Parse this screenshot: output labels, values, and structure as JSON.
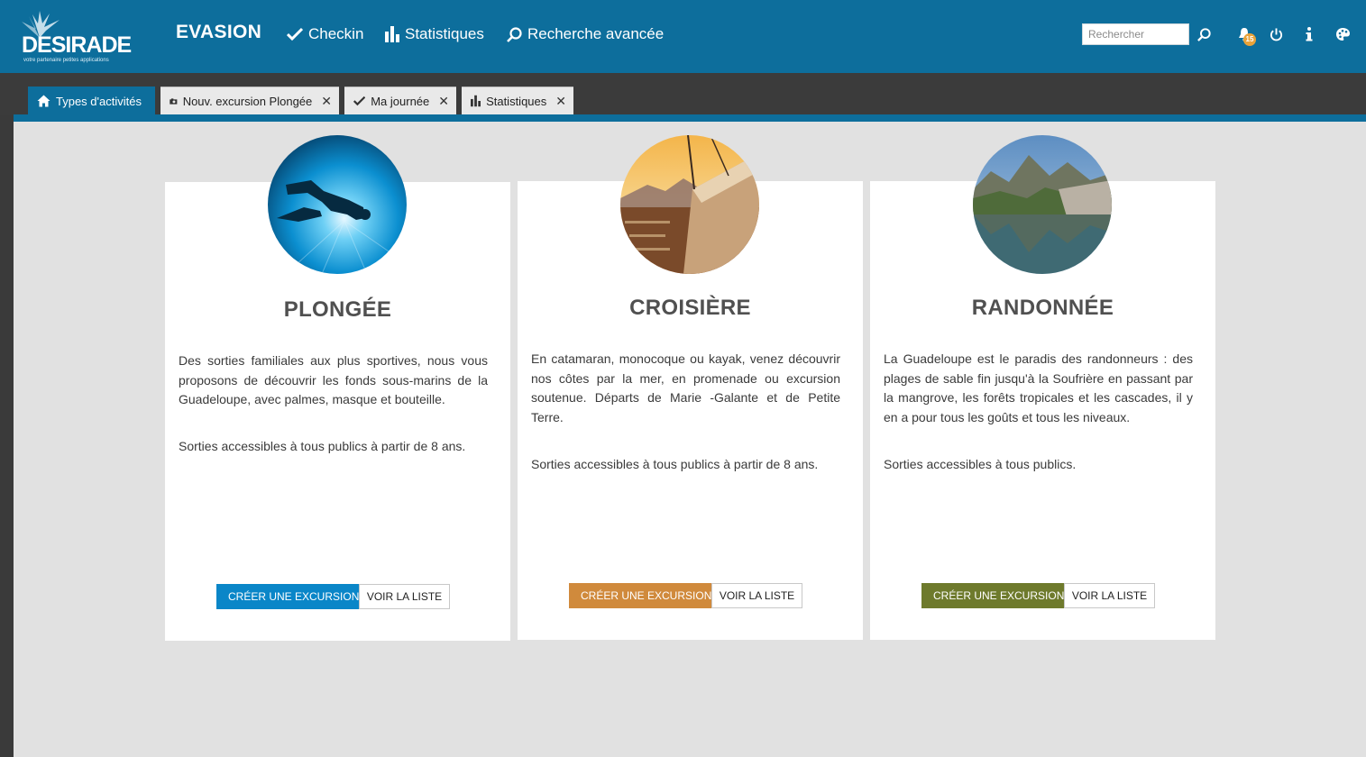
{
  "header": {
    "logo_text": "DESIRADE",
    "logo_tagline": "votre partenaire petites applications",
    "app_name": "EVASION",
    "nav": [
      {
        "label": "Checkin",
        "icon": "check-icon"
      },
      {
        "label": "Statistiques",
        "icon": "bar-chart-icon"
      },
      {
        "label": "Recherche avancée",
        "icon": "search-icon"
      }
    ],
    "search_placeholder": "Rechercher",
    "notification_count": "15",
    "accent_color": "#0d6e9c"
  },
  "tabs": [
    {
      "label": "Types d'activités",
      "icon": "home-icon",
      "active": true
    },
    {
      "label": "Nouv. excursion Plongée",
      "icon": "camera-icon",
      "closable": true
    },
    {
      "label": "Ma journée",
      "icon": "check-icon",
      "closable": true
    },
    {
      "label": "Statistiques",
      "icon": "bar-chart-icon",
      "closable": true
    }
  ],
  "cards": [
    {
      "title": "PLONGÉE",
      "image": "diver-photo",
      "description": "Des sorties familiales aux plus sportives, nous vous proposons de découvrir les fonds sous-marins de la Guadeloupe, avec palmes, masque et bouteille.",
      "note": "Sorties accessibles à tous publics à partir de 8 ans.",
      "create_label": "CRÉER UNE EXCURSION",
      "list_label": "VOIR LA LISTE",
      "color": "#0a86c8"
    },
    {
      "title": "CROISIÈRE",
      "image": "sailboat-photo",
      "description": "En catamaran, monocoque ou kayak, venez découvrir nos côtes par la mer, en promenade ou excursion soutenue. Départs de Marie -Galante et de Petite Terre.",
      "note": "Sorties accessibles à tous publics à partir de 8 ans.",
      "create_label": "CRÉER UNE EXCURSION",
      "list_label": "VOIR LA LISTE",
      "color": "#d08a3c"
    },
    {
      "title": "RANDONNÉE",
      "image": "mountain-lake-photo",
      "description": "La Guadeloupe est le paradis des randonneurs : des plages de sable fin jusqu'à la Soufrière en passant par la mangrove, les forêts tropicales et les cascades, il y en a pour tous les goûts et tous les niveaux.",
      "note": "Sorties accessibles à tous publics.",
      "create_label": "CRÉER UNE EXCURSION",
      "list_label": "VOIR LA LISTE",
      "color": "#6e7a2c"
    }
  ]
}
